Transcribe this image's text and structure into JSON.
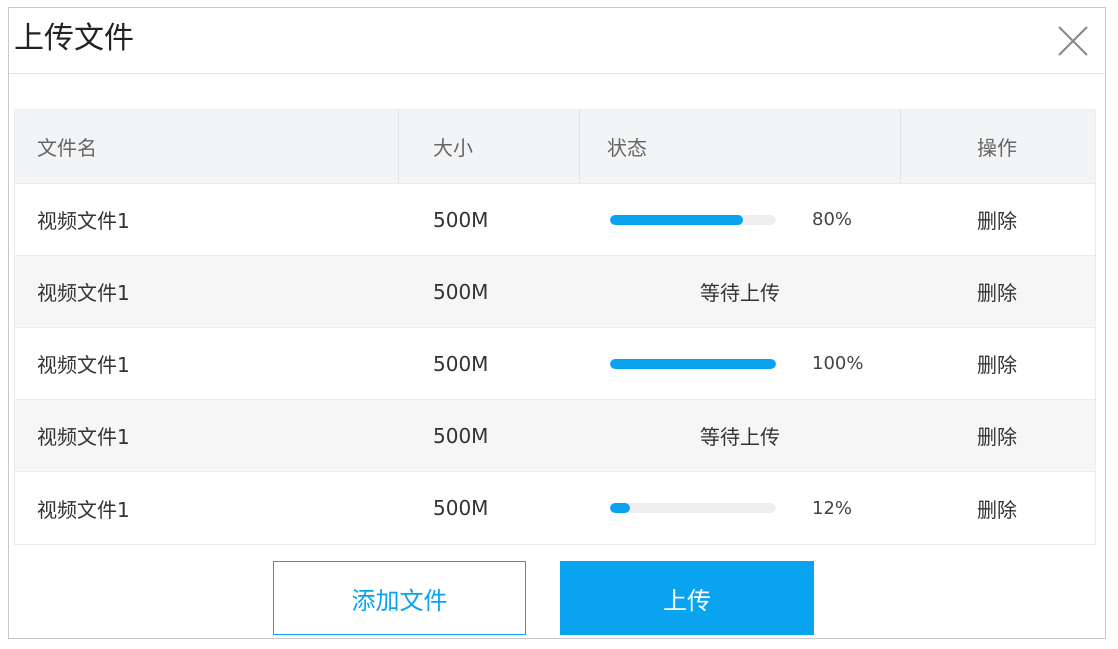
{
  "dialog": {
    "title": "上传文件",
    "close_icon": "close-icon"
  },
  "table": {
    "columns": [
      "文件名",
      "大小",
      "状态",
      "操作"
    ],
    "rows": [
      {
        "name": "视频文件1",
        "size": "500M",
        "status_type": "progress",
        "progress": 0.8,
        "percent_label": "80%",
        "action": "删除"
      },
      {
        "name": "视频文件1",
        "size": "500M",
        "status_type": "text",
        "status_text": "等待上传",
        "action": "删除"
      },
      {
        "name": "视频文件1",
        "size": "500M",
        "status_type": "progress",
        "progress": 1.0,
        "percent_label": "100%",
        "action": "删除"
      },
      {
        "name": "视频文件1",
        "size": "500M",
        "status_type": "text",
        "status_text": "等待上传",
        "action": "删除"
      },
      {
        "name": "视频文件1",
        "size": "500M",
        "status_type": "progress",
        "progress": 0.12,
        "percent_label": "12%",
        "action": "删除"
      }
    ]
  },
  "footer": {
    "add_label": "添加文件",
    "upload_label": "上传"
  },
  "colors": {
    "accent": "#0aa3f0",
    "track": "#eeeeee",
    "header_bg": "#f3f4f6",
    "alt_row_bg": "#f6f6f6"
  }
}
